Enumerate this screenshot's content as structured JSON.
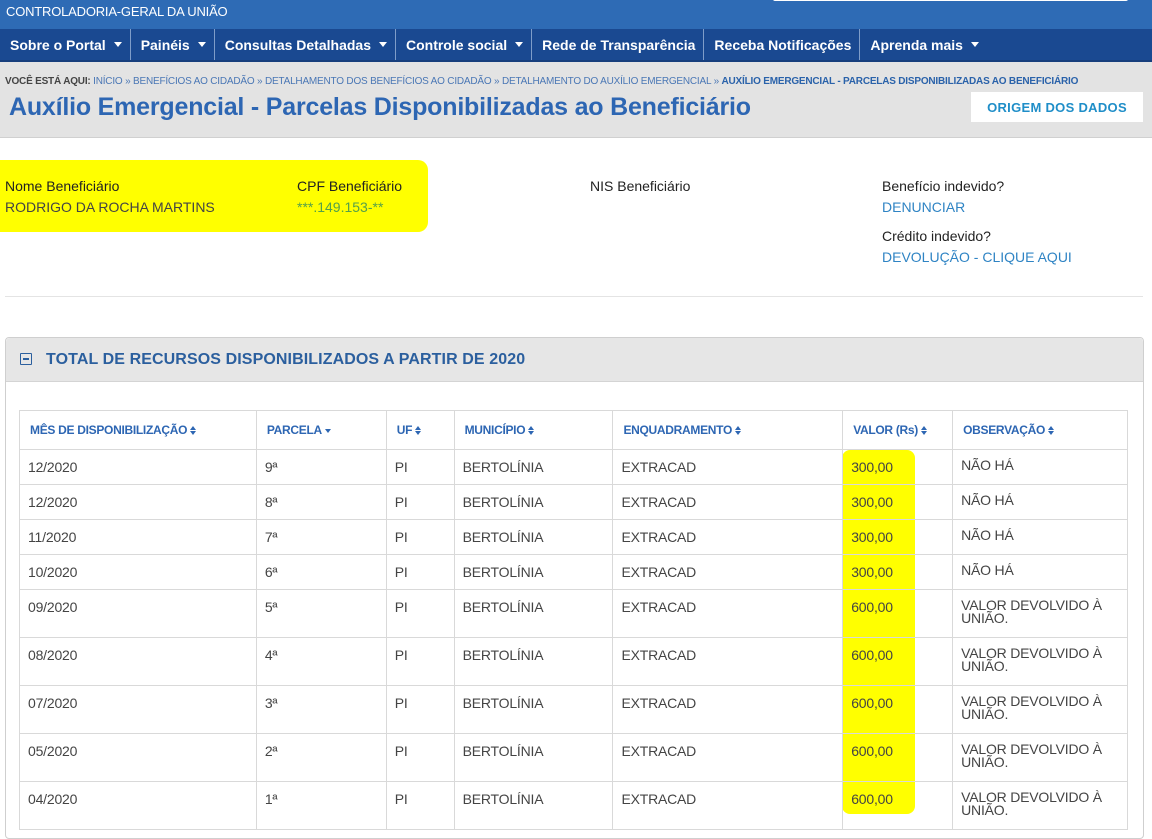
{
  "header": {
    "org": "CONTROLADORIA-GERAL DA UNIÃO"
  },
  "nav": [
    {
      "label": "Sobre o Portal",
      "dropdown": true
    },
    {
      "label": "Painéis",
      "dropdown": true
    },
    {
      "label": "Consultas Detalhadas",
      "dropdown": true
    },
    {
      "label": "Controle social",
      "dropdown": true
    },
    {
      "label": "Rede de Transparência",
      "dropdown": false
    },
    {
      "label": "Receba Notificações",
      "dropdown": false
    },
    {
      "label": "Aprenda mais",
      "dropdown": true
    }
  ],
  "breadcrumb": {
    "you_are_here": "VOCÊ ESTÁ AQUI:",
    "items": [
      "INÍCIO",
      "BENEFÍCIOS AO CIDADÃO",
      "DETALHAMENTO DOS BENEFÍCIOS AO CIDADÃO",
      "DETALHAMENTO DO AUXÍLIO EMERGENCIAL"
    ],
    "current": "AUXÍLIO EMERGENCIAL - PARCELAS DISPONIBILIZADAS AO BENEFICIÁRIO"
  },
  "page": {
    "title": "Auxílio Emergencial - Parcelas Disponibilizadas ao Beneficiário",
    "origem_button": "ORIGEM DOS DADOS"
  },
  "beneficiary": {
    "name_label": "Nome Beneficiário",
    "name_value": "RODRIGO DA ROCHA MARTINS",
    "cpf_label": "CPF Beneficiário",
    "cpf_value": "***.149.153-**",
    "nis_label": "NIS Beneficiário",
    "beneficio_label": "Benefício indevido?",
    "beneficio_link": "DENUNCIAR",
    "credito_label": "Crédito indevido?",
    "credito_link": "DEVOLUÇÃO - CLIQUE AQUI"
  },
  "panel": {
    "title": "TOTAL DE RECURSOS DISPONIBILIZADOS A PARTIR DE 2020"
  },
  "table": {
    "columns": [
      "MÊS DE DISPONIBILIZAÇÃO",
      "PARCELA",
      "UF",
      "MUNICÍPIO",
      "ENQUADRAMENTO",
      "VALOR (Rs)",
      "OBSERVAÇÃO"
    ],
    "rows": [
      {
        "mes": "12/2020",
        "parcela": "9ª",
        "uf": "PI",
        "municipio": "BERTOLÍNIA",
        "enquadramento": "EXTRACAD",
        "valor": "300,00",
        "obs": "NÃO HÁ"
      },
      {
        "mes": "12/2020",
        "parcela": "8ª",
        "uf": "PI",
        "municipio": "BERTOLÍNIA",
        "enquadramento": "EXTRACAD",
        "valor": "300,00",
        "obs": "NÃO HÁ"
      },
      {
        "mes": "11/2020",
        "parcela": "7ª",
        "uf": "PI",
        "municipio": "BERTOLÍNIA",
        "enquadramento": "EXTRACAD",
        "valor": "300,00",
        "obs": "NÃO HÁ"
      },
      {
        "mes": "10/2020",
        "parcela": "6ª",
        "uf": "PI",
        "municipio": "BERTOLÍNIA",
        "enquadramento": "EXTRACAD",
        "valor": "300,00",
        "obs": "NÃO HÁ"
      },
      {
        "mes": "09/2020",
        "parcela": "5ª",
        "uf": "PI",
        "municipio": "BERTOLÍNIA",
        "enquadramento": "EXTRACAD",
        "valor": "600,00",
        "obs": "VALOR DEVOLVIDO À UNIÃO."
      },
      {
        "mes": "08/2020",
        "parcela": "4ª",
        "uf": "PI",
        "municipio": "BERTOLÍNIA",
        "enquadramento": "EXTRACAD",
        "valor": "600,00",
        "obs": "VALOR DEVOLVIDO À UNIÃO."
      },
      {
        "mes": "07/2020",
        "parcela": "3ª",
        "uf": "PI",
        "municipio": "BERTOLÍNIA",
        "enquadramento": "EXTRACAD",
        "valor": "600,00",
        "obs": "VALOR DEVOLVIDO À UNIÃO."
      },
      {
        "mes": "05/2020",
        "parcela": "2ª",
        "uf": "PI",
        "municipio": "BERTOLÍNIA",
        "enquadramento": "EXTRACAD",
        "valor": "600,00",
        "obs": "VALOR DEVOLVIDO À UNIÃO."
      },
      {
        "mes": "04/2020",
        "parcela": "1ª",
        "uf": "PI",
        "municipio": "BERTOLÍNIA",
        "enquadramento": "EXTRACAD",
        "valor": "600,00",
        "obs": "VALOR DEVOLVIDO À UNIÃO."
      }
    ]
  },
  "colors": {
    "highlight": "#ffff00",
    "nav_bg": "#1a4991",
    "top_bg": "#2e6bb5",
    "title_blue": "#2d66b3",
    "link_blue": "#2f84c4"
  },
  "icons": {
    "collapse": "minus-square-icon",
    "sort": "sort-arrows-icon",
    "dropdown": "caret-down-icon"
  }
}
